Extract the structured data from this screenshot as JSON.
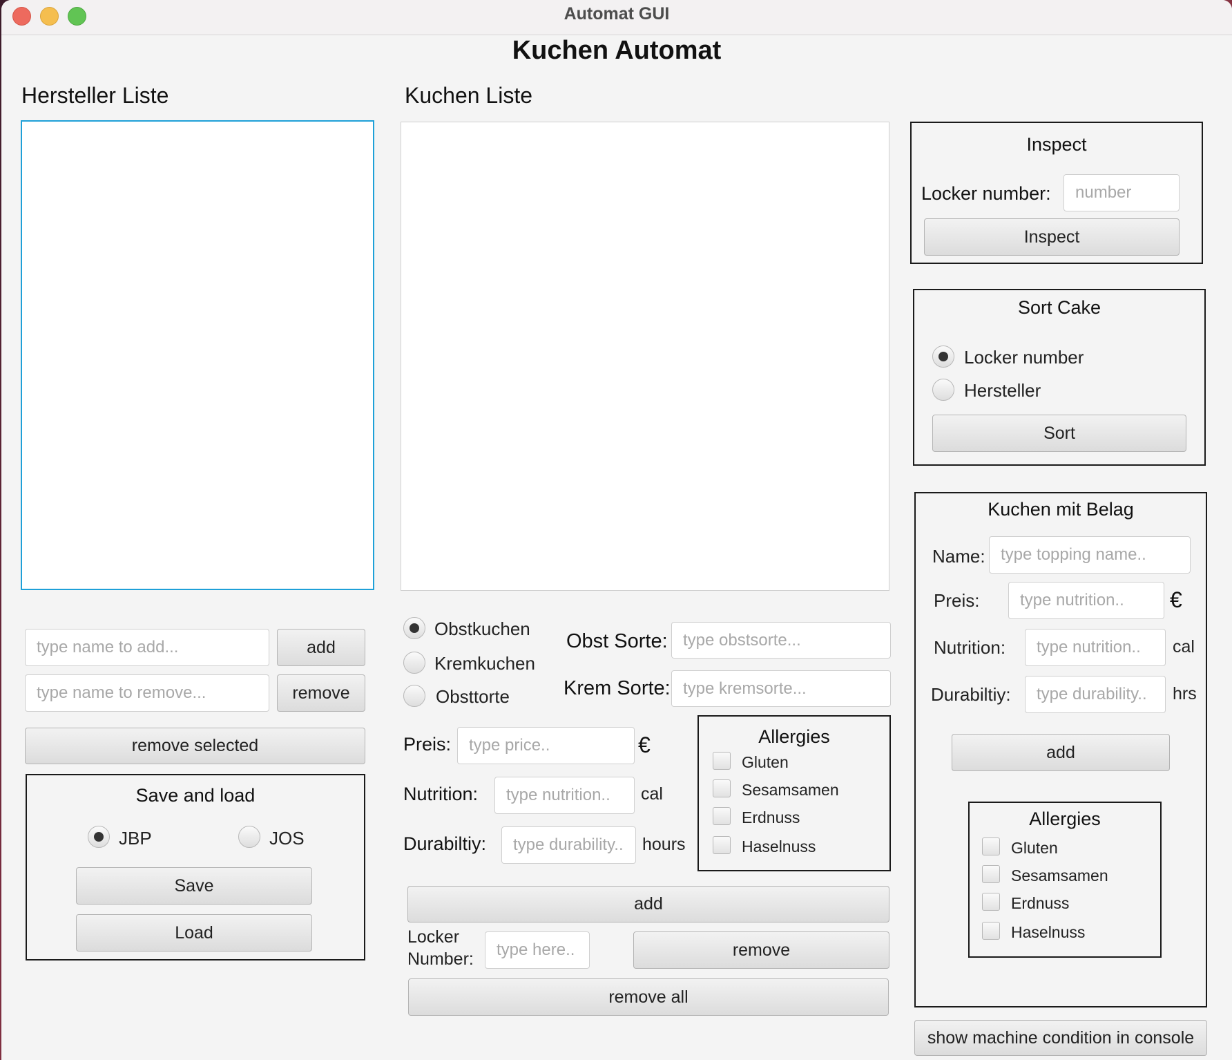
{
  "window": {
    "title": "Automat GUI"
  },
  "app": {
    "title": "Kuchen Automat"
  },
  "hersteller": {
    "heading": "Hersteller Liste",
    "add_placeholder": "type name to add...",
    "add_label": "add",
    "remove_placeholder": "type name to remove...",
    "remove_label": "remove",
    "remove_selected_label": "remove selected"
  },
  "save_load": {
    "title": "Save and load",
    "options": [
      "JBP",
      "JOS"
    ],
    "selected": "JBP",
    "save_label": "Save",
    "load_label": "Load"
  },
  "kuchen": {
    "heading": "Kuchen Liste",
    "types": [
      "Obstkuchen",
      "Kremkuchen",
      "Obsttorte"
    ],
    "selected_type": "Obstkuchen",
    "obst_label": "Obst Sorte:",
    "obst_placeholder": "type obstsorte...",
    "krem_label": "Krem Sorte:",
    "krem_placeholder": "type kremsorte...",
    "preis_label": "Preis:",
    "preis_placeholder": "type price..",
    "preis_unit": "€",
    "nutrition_label": "Nutrition:",
    "nutrition_placeholder": "type nutrition..",
    "nutrition_unit": "cal",
    "durability_label": "Durabiltiy:",
    "durability_placeholder": "type durability..",
    "durability_unit": "hours",
    "allergies_title": "Allergies",
    "allergies": [
      "Gluten",
      "Sesamsamen",
      "Erdnuss",
      "Haselnuss"
    ],
    "add_label": "add",
    "locker_label_1": "Locker",
    "locker_label_2": "Number:",
    "locker_placeholder": "type here..",
    "remove_label": "remove",
    "remove_all_label": "remove all"
  },
  "inspect": {
    "title": "Inspect",
    "locker_label": "Locker number:",
    "locker_placeholder": "number",
    "button_label": "Inspect"
  },
  "sort": {
    "title": "Sort Cake",
    "options": [
      "Locker number",
      "Hersteller"
    ],
    "selected": "Locker number",
    "button_label": "Sort"
  },
  "belag": {
    "title": "Kuchen mit Belag",
    "name_label": "Name:",
    "name_placeholder": "type topping name..",
    "preis_label": "Preis:",
    "preis_placeholder": "type nutrition..",
    "preis_unit": "€",
    "nutrition_label": "Nutrition:",
    "nutrition_placeholder": "type nutrition..",
    "nutrition_unit": "cal",
    "durability_label": "Durabiltiy:",
    "durability_placeholder": "type durability..",
    "durability_unit": "hrs",
    "add_label": "add",
    "allergies_title": "Allergies",
    "allergies": [
      "Gluten",
      "Sesamsamen",
      "Erdnuss",
      "Haselnuss"
    ]
  },
  "console_button_label": "show machine condition in console",
  "colors": {
    "focus_border": "#1ea0d8",
    "panel_border": "#1a1a1a",
    "window_bg": "#f4f4f4"
  }
}
